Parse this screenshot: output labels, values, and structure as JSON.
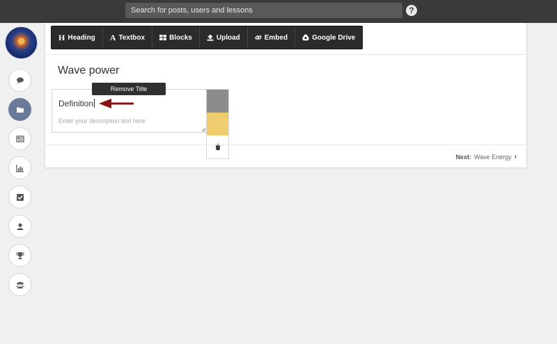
{
  "topbar": {
    "search_placeholder": "Search for posts, users and lessons",
    "help_glyph": "?"
  },
  "sidebar": {
    "items": [
      {
        "name": "chat-icon",
        "active": false
      },
      {
        "name": "folder-icon",
        "active": true
      },
      {
        "name": "newspaper-icon",
        "active": false
      },
      {
        "name": "bar-chart-icon",
        "active": false
      },
      {
        "name": "checkbox-icon",
        "active": false
      },
      {
        "name": "user-icon",
        "active": false
      },
      {
        "name": "trophy-icon",
        "active": false
      },
      {
        "name": "group-icon",
        "active": false
      }
    ]
  },
  "toolbar": {
    "heading": "Heading",
    "textbox": "Textbox",
    "blocks": "Blocks",
    "upload": "Upload",
    "embed": "Embed",
    "google_drive": "Google Drive"
  },
  "page": {
    "title": "Wave power"
  },
  "editor": {
    "heading_text": "Definition",
    "description_placeholder": "Enter your description text here",
    "tooltip": "Remove Title"
  },
  "swatches": {
    "colors": [
      "#8c8c8c",
      "#f0cd6e"
    ],
    "trash_icon": "trash-icon"
  },
  "footer": {
    "next_label": "Next:",
    "next_value": "Wave Energy"
  },
  "colors": {
    "topbar": "#3a3a3a",
    "toolbar": "#2b2b2b",
    "active_side": "#6b7a99",
    "arrow": "#8b1010"
  }
}
